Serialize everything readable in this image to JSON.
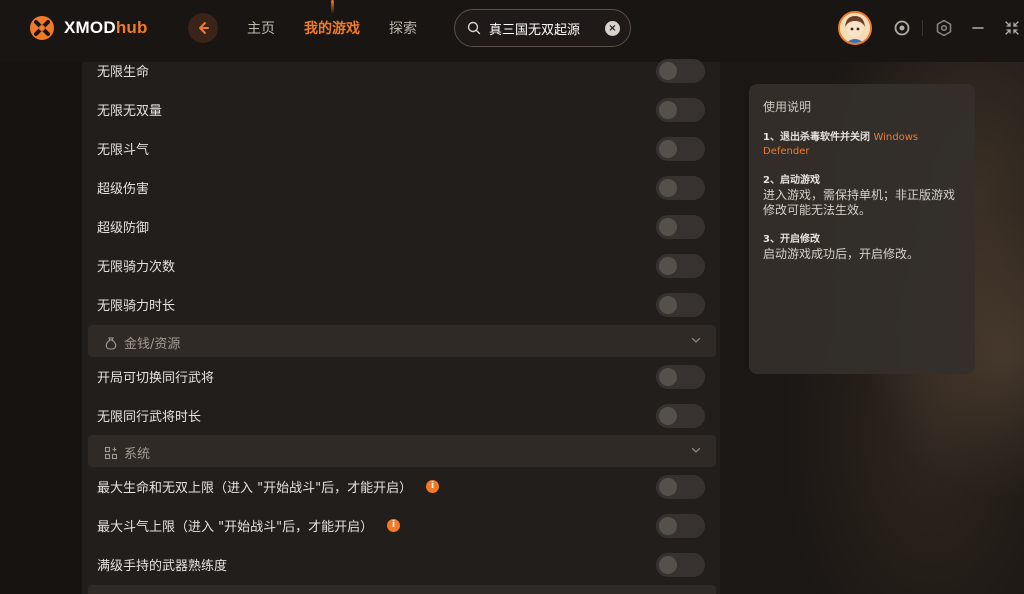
{
  "app": {
    "logo_main": "XMOD",
    "logo_accent": "hub"
  },
  "nav": {
    "home": "主页",
    "my_games": "我的游戏",
    "explore": "探索"
  },
  "search": {
    "value": "真三国无双起源"
  },
  "colors": {
    "accent": "#f07a2a",
    "panel": "#221e1b",
    "toggle_off": "#373230"
  },
  "rows_a": [
    {
      "label": "无限生命",
      "enabled": false
    },
    {
      "label": "无限无双量",
      "enabled": false
    },
    {
      "label": "无限斗气",
      "enabled": false
    },
    {
      "label": "超级伤害",
      "enabled": false
    },
    {
      "label": "超级防御",
      "enabled": false
    },
    {
      "label": "无限骑力次数",
      "enabled": false
    },
    {
      "label": "无限骑力时长",
      "enabled": false
    }
  ],
  "section_money": {
    "title": "金钱/资源",
    "icon": "money-bag-icon"
  },
  "rows_b": [
    {
      "label": "开局可切换同行武将",
      "enabled": false
    },
    {
      "label": "无限同行武将时长",
      "enabled": false
    }
  ],
  "section_system": {
    "title": "系统",
    "icon": "grid-icon"
  },
  "rows_c": [
    {
      "label": "最大生命和无双上限（进入 \"开始战斗\"后，才能开启）",
      "enabled": false,
      "info": true
    },
    {
      "label": "最大斗气上限（进入 \"开始战斗\"后，才能开启）",
      "enabled": false,
      "info": true
    },
    {
      "label": "满级手持的武器熟练度",
      "enabled": false
    }
  ],
  "help": {
    "title": "使用说明",
    "step1_title": "1、退出杀毒软件并关闭",
    "step1_highlight": "Windows Defender",
    "step2_title": "2、启动游戏",
    "step2_body": "进入游戏，需保持单机；非正版游戏修改可能无法生效。",
    "step3_title": "3、开启修改",
    "step3_body": "启动游戏成功后，开启修改。"
  }
}
